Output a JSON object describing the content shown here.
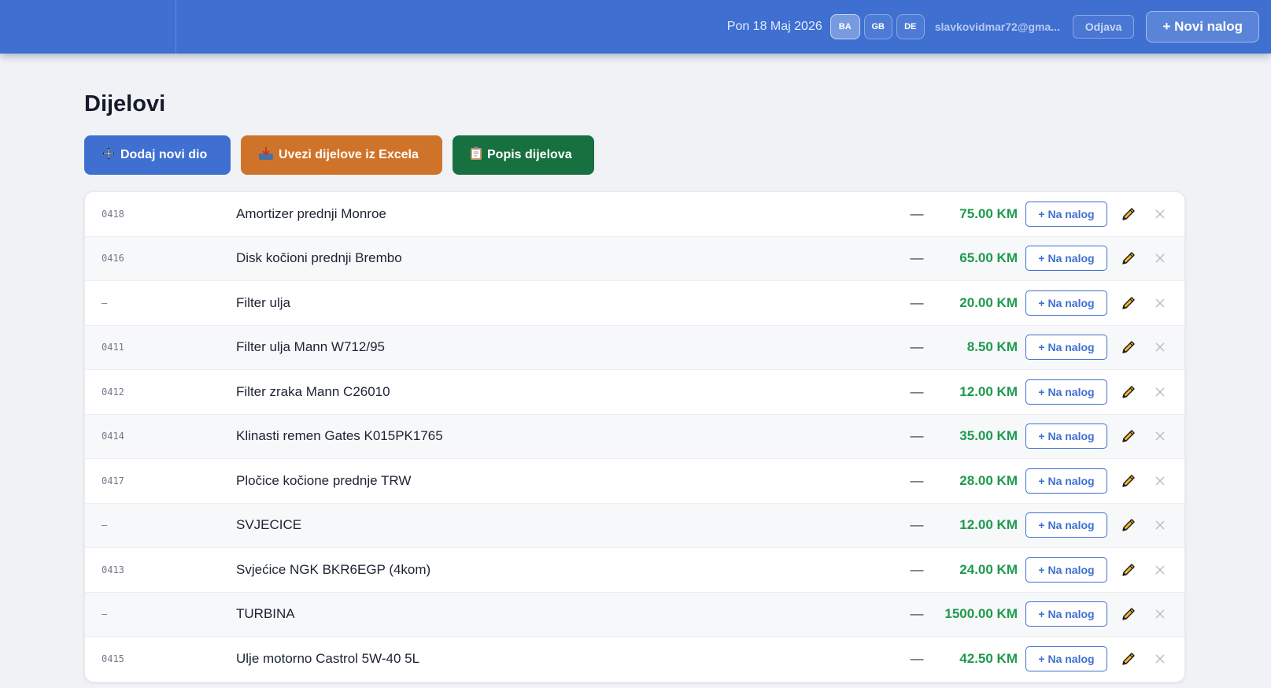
{
  "header": {
    "date": "Pon 18 Maj 2026",
    "languages": [
      "BA",
      "GB",
      "DE"
    ],
    "active_language": "BA",
    "email": "slavkovidmar72@gma...",
    "logout_label": "Odjava",
    "new_order_label": "+ Novi nalog"
  },
  "page": {
    "title": "Dijelovi",
    "actions": {
      "add_part_label": "Dodaj novi dio",
      "import_label": "Uvezi dijelove iz Excela",
      "list_label": "Popis dijelova"
    }
  },
  "parts": [
    {
      "code": "0418",
      "name": "Amortizer prednji Monroe",
      "qty": "—",
      "price": "75.00 KM"
    },
    {
      "code": "0416",
      "name": "Disk kočioni prednji Brembo",
      "qty": "—",
      "price": "65.00 KM"
    },
    {
      "code": "–",
      "name": "Filter ulja",
      "qty": "—",
      "price": "20.00 KM"
    },
    {
      "code": "0411",
      "name": "Filter ulja Mann W712/95",
      "qty": "—",
      "price": "8.50 KM"
    },
    {
      "code": "0412",
      "name": "Filter zraka Mann C26010",
      "qty": "—",
      "price": "12.00 KM"
    },
    {
      "code": "0414",
      "name": "Klinasti remen Gates K015PK1765",
      "qty": "—",
      "price": "35.00 KM"
    },
    {
      "code": "0417",
      "name": "Pločice kočione prednje TRW",
      "qty": "—",
      "price": "28.00 KM"
    },
    {
      "code": "–",
      "name": "SVJECICE",
      "qty": "—",
      "price": "12.00 KM"
    },
    {
      "code": "0413",
      "name": "Svjećice NGK BKR6EGP (4kom)",
      "qty": "—",
      "price": "24.00 KM"
    },
    {
      "code": "–",
      "name": "TURBINA",
      "qty": "—",
      "price": "1500.00 KM"
    },
    {
      "code": "0415",
      "name": "Ulje motorno Castrol 5W-40 5L",
      "qty": "—",
      "price": "42.50 KM"
    }
  ],
  "row_labels": {
    "add_to_order": "+ Na nalog"
  },
  "icons": {
    "add": "plus-icon",
    "import": "inbox-tray-icon",
    "list": "clipboard-icon",
    "edit": "pencil-icon",
    "delete": "close-icon"
  },
  "colors": {
    "primary": "#3e6fd1",
    "orange": "#d0732a",
    "green": "#17703f",
    "price": "#1e9a4f"
  }
}
